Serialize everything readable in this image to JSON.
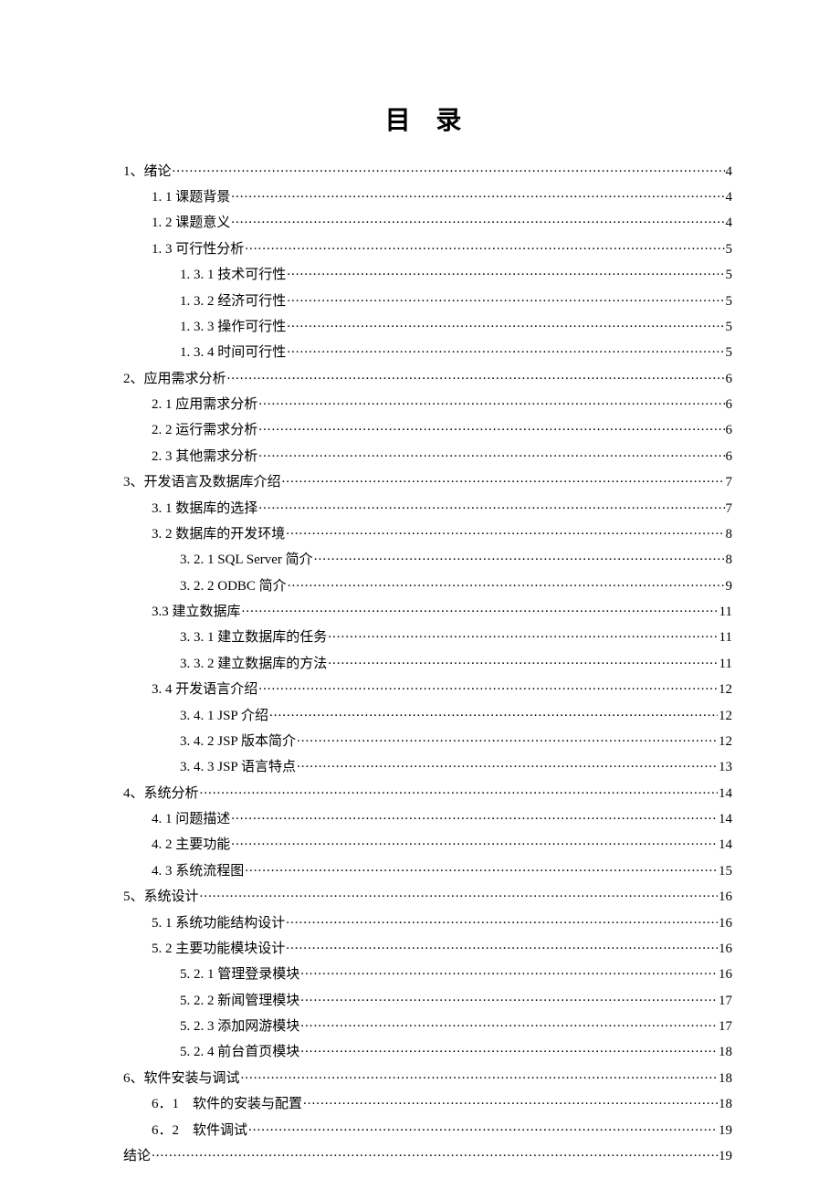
{
  "title": "目 录",
  "entries": [
    {
      "level": 1,
      "label": "1、绪论",
      "page": "4"
    },
    {
      "level": 2,
      "label": "1. 1 课题背景",
      "page": "4"
    },
    {
      "level": 2,
      "label": "1. 2 课题意义",
      "page": "4"
    },
    {
      "level": 2,
      "label": "1. 3 可行性分析",
      "page": "5"
    },
    {
      "level": 3,
      "label": "1. 3. 1 技术可行性",
      "page": "5"
    },
    {
      "level": 3,
      "label": "1. 3. 2 经济可行性",
      "page": "5"
    },
    {
      "level": 3,
      "label": "1. 3. 3 操作可行性",
      "page": "5"
    },
    {
      "level": 3,
      "label": "1. 3. 4 时间可行性",
      "page": "5"
    },
    {
      "level": 1,
      "label": "2、应用需求分析",
      "page": "6"
    },
    {
      "level": 2,
      "label": "2. 1 应用需求分析",
      "page": "6"
    },
    {
      "level": 2,
      "label": "2. 2 运行需求分析",
      "page": "6"
    },
    {
      "level": 2,
      "label": "2. 3 其他需求分析",
      "page": "6"
    },
    {
      "level": 1,
      "label": "3、开发语言及数据库介绍",
      "page": "7"
    },
    {
      "level": 2,
      "label": "3. 1 数据库的选择",
      "page": "7"
    },
    {
      "level": 2,
      "label": "3. 2 数据库的开发环境",
      "page": "8"
    },
    {
      "level": 3,
      "label": "3. 2. 1 SQL Server 简介",
      "page": "8"
    },
    {
      "level": 3,
      "label": "3. 2. 2 ODBC 简介",
      "page": "9"
    },
    {
      "level": 2,
      "label": "3.3 建立数据库",
      "page": "11"
    },
    {
      "level": 3,
      "label": "3. 3. 1 建立数据库的任务",
      "page": "11"
    },
    {
      "level": 3,
      "label": "3. 3. 2 建立数据库的方法",
      "page": "11"
    },
    {
      "level": 2,
      "label": "3. 4 开发语言介绍",
      "page": "12"
    },
    {
      "level": 3,
      "label": "3. 4. 1 JSP 介绍",
      "page": "12"
    },
    {
      "level": 3,
      "label": "3. 4. 2 JSP 版本简介",
      "page": "12"
    },
    {
      "level": 3,
      "label": "3. 4. 3 JSP 语言特点",
      "page": "13"
    },
    {
      "level": 1,
      "label": "4、系统分析",
      "page": "14"
    },
    {
      "level": 2,
      "label": "4. 1 问题描述",
      "page": "14"
    },
    {
      "level": 2,
      "label": "4. 2 主要功能",
      "page": "14"
    },
    {
      "level": 2,
      "label": "4. 3 系统流程图",
      "page": "15"
    },
    {
      "level": 1,
      "label": "5、系统设计",
      "page": "16"
    },
    {
      "level": 2,
      "label": "5. 1 系统功能结构设计",
      "page": "16"
    },
    {
      "level": 2,
      "label": "5. 2 主要功能模块设计",
      "page": "16"
    },
    {
      "level": 3,
      "label": "5. 2. 1 管理登录模块",
      "page": "16"
    },
    {
      "level": 3,
      "label": "5. 2. 2 新闻管理模块",
      "page": "17"
    },
    {
      "level": 3,
      "label": "5. 2. 3 添加网游模块",
      "page": "17"
    },
    {
      "level": 3,
      "label": "5. 2. 4 前台首页模块",
      "page": "18"
    },
    {
      "level": 1,
      "label": "6、软件安装与调试",
      "page": "18"
    },
    {
      "level": 2,
      "label": "6．1　软件的安装与配置",
      "page": "18"
    },
    {
      "level": 2,
      "label": "6．2　软件调试",
      "page": "19"
    },
    {
      "level": 1,
      "label": "结论",
      "page": "19"
    }
  ]
}
